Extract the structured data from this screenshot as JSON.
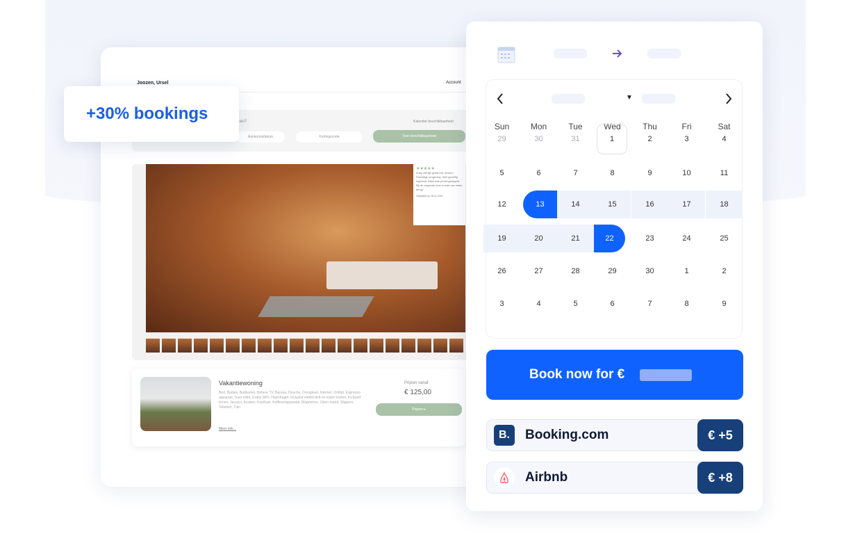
{
  "mock": {
    "host": "Joozen, Ursel",
    "account": "Account",
    "question": "...en?",
    "calendar_link": "Kalender beschikbaarheid",
    "date_placeholder": "Aankomstdatum",
    "promo_placeholder": "Kortingscode",
    "show_button": "Toon beschikbaarheid",
    "review": {
      "stars": "★★★★★",
      "text": "Zolig verblijf gehad bij Jozzen! Prachtige omgeving, heel gezellig ingericht. Alles was prima geregeld. Bij de volgende keer komen we zeker terug!",
      "date": "Geplaatst op 18-11-2021"
    },
    "listing": {
      "title": "Vakantiewoning",
      "accessible_icon": "wheelchair-icon",
      "info_icon": "info-icon",
      "description": "Bed, Badjas, Badkamer, Beheer TV, Bureau, Douche, Droogkast, Internet, Ontbijt, Espresso-apparaat, Gast toilet, Gratis WiFi, Haardrager, Inclusief elektriciteit en water kosten, Inclusief linnen, Jacuzzi, Keuken, Koelkast, Koffiezetapparaat, Magnetron, Open haard, Slippers, Toiletten, Tuin",
      "more": "Meer info...",
      "price_label": "Prijzen vanaf",
      "price": "€ 125,00",
      "prices_button": "Prijzen ▸"
    }
  },
  "badge": {
    "text": "+30% bookings"
  },
  "booking": {
    "header_icon": "calendar-icon",
    "arrow_icon": "arrow-right-icon",
    "weekdays": [
      "Sun",
      "Mon",
      "Tue",
      "Wed",
      "Thu",
      "Fri",
      "Sat"
    ],
    "weeks": [
      [
        "29",
        "30",
        "31",
        "1",
        "2",
        "3",
        "4"
      ],
      [
        "5",
        "6",
        "7",
        "8",
        "9",
        "10",
        "11"
      ],
      [
        "12",
        "13",
        "14",
        "15",
        "16",
        "17",
        "18"
      ],
      [
        "19",
        "20",
        "21",
        "22",
        "23",
        "24",
        "25"
      ],
      [
        "26",
        "27",
        "28",
        "29",
        "30",
        "1",
        "2"
      ],
      [
        "3",
        "4",
        "5",
        "6",
        "7",
        "8",
        "9"
      ]
    ],
    "today": "1",
    "range_start": "13",
    "range_end": "22",
    "book_label": "Book now for €",
    "otas": [
      {
        "name": "Booking.com",
        "logo": "B.",
        "price": "€ +5"
      },
      {
        "name": "Airbnb",
        "logo": "airbnb-icon",
        "price": "€ +8"
      }
    ],
    "colors": {
      "primary": "#0f62fe",
      "ota_price": "#173f7a",
      "range": "#eef2fb"
    }
  }
}
